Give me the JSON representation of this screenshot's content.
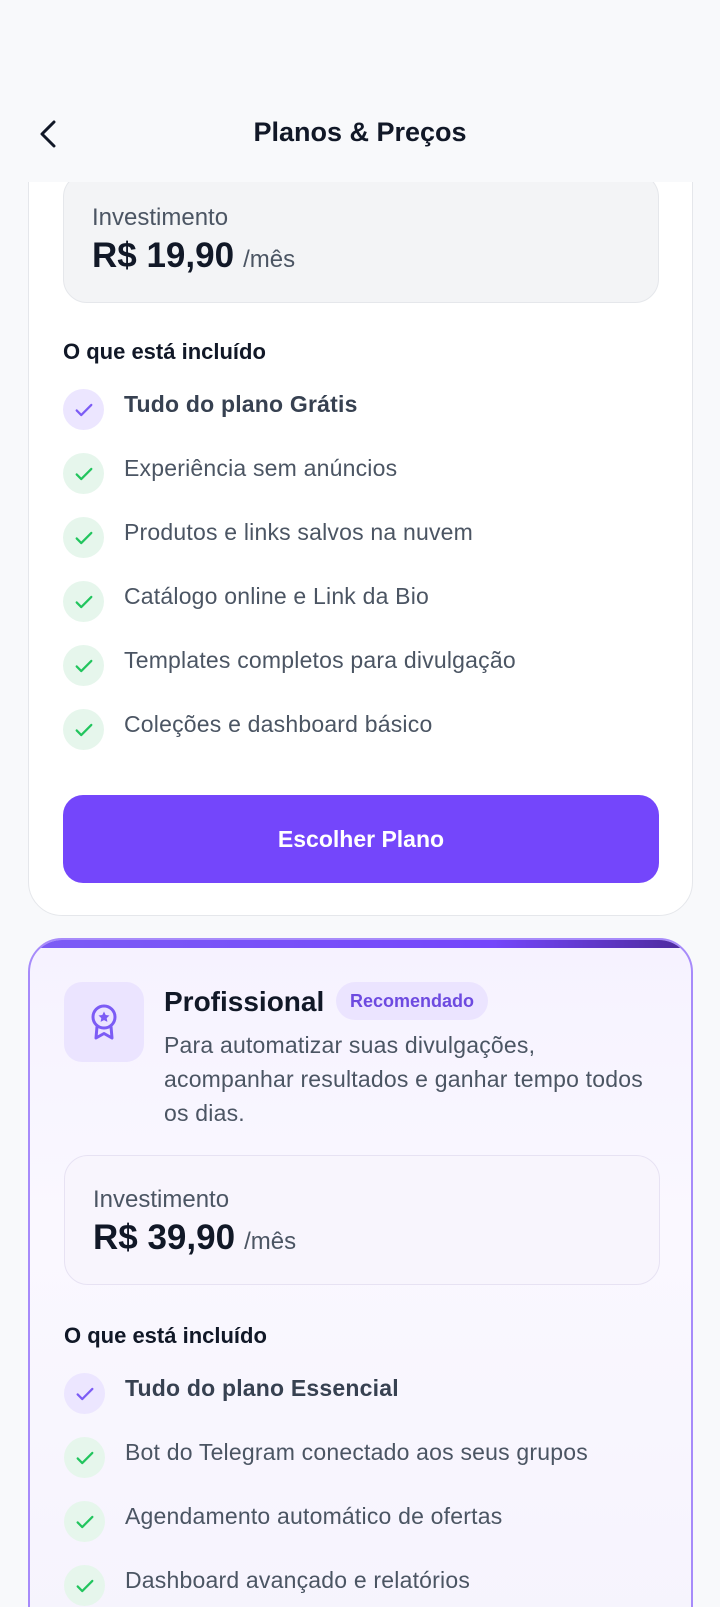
{
  "header": {
    "title": "Planos & Preços",
    "back_icon": "chevron-left-icon"
  },
  "essencial": {
    "investment_label": "Investimento",
    "price": "R$ 19,90",
    "period": "/mês",
    "included_title": "O que está incluído",
    "features": [
      {
        "text": "Tudo do plano Grátis",
        "highlight": true
      },
      {
        "text": "Experiência sem anúncios",
        "highlight": false
      },
      {
        "text": "Produtos e links salvos na nuvem",
        "highlight": false
      },
      {
        "text": "Catálogo online e Link da Bio",
        "highlight": false
      },
      {
        "text": "Templates completos para divulgação",
        "highlight": false
      },
      {
        "text": "Coleções e dashboard básico",
        "highlight": false
      }
    ],
    "cta_label": "Escolher Plano"
  },
  "profissional": {
    "name": "Profissional",
    "badge": "Recomendado",
    "description": "Para automatizar suas divulgações, acompanhar resultados e ganhar tempo todos os dias.",
    "icon": "award-icon",
    "investment_label": "Investimento",
    "price": "R$ 39,90",
    "period": "/mês",
    "included_title": "O que está incluído",
    "features": [
      {
        "text": "Tudo do plano Essencial",
        "highlight": true
      },
      {
        "text": "Bot do Telegram conectado aos seus grupos",
        "highlight": false
      },
      {
        "text": "Agendamento automático de ofertas",
        "highlight": false
      },
      {
        "text": "Dashboard avançado e relatórios",
        "highlight": false
      }
    ]
  },
  "colors": {
    "accent": "#7446fb",
    "check_green": "#22c55e",
    "check_purple": "#7c5cf5",
    "badge_bg": "#ebe4ff"
  }
}
